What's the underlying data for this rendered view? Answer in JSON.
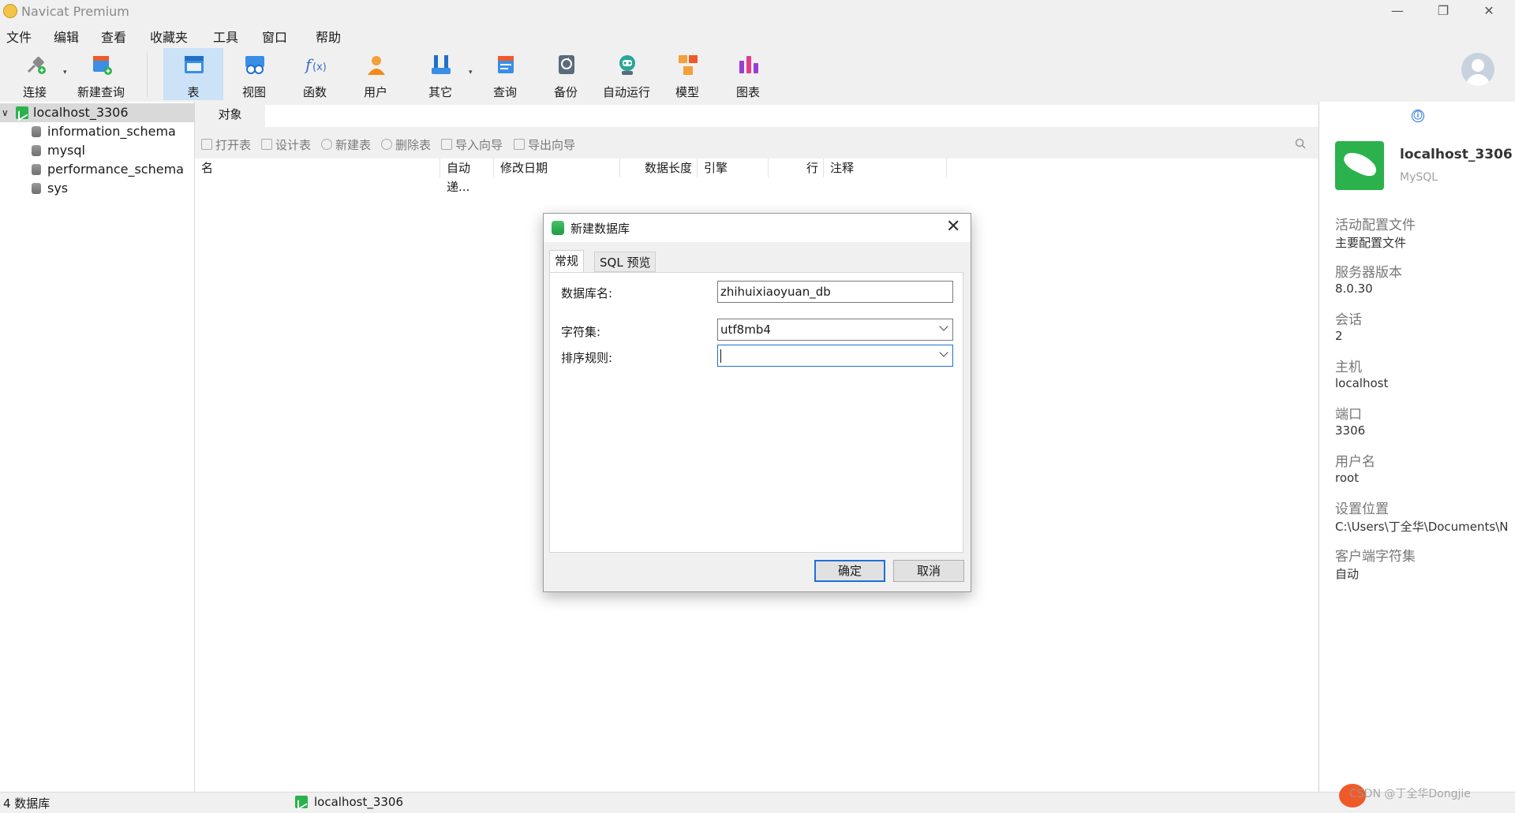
{
  "window": {
    "title": "Navicat Premium",
    "controls": [
      "—",
      "❐",
      "✕"
    ]
  },
  "menu": [
    "文件",
    "编辑",
    "查看",
    "收藏夹",
    "工具",
    "窗口",
    "帮助"
  ],
  "toolbar": {
    "connect": "连接",
    "new_query": "新建查询",
    "table": "表",
    "view": "视图",
    "function": "函数",
    "user": "用户",
    "other": "其它",
    "query": "查询",
    "backup": "备份",
    "automation": "自动运行",
    "model": "模型",
    "chart": "图表",
    "active": "table"
  },
  "tree": {
    "connection": "localhost_3306",
    "expand_icon": "∨",
    "databases": [
      "information_schema",
      "mysql",
      "performance_schema",
      "sys"
    ]
  },
  "objects": {
    "tab_label": "对象",
    "actions": [
      "打开表",
      "设计表",
      "新建表",
      "删除表",
      "导入向导",
      "导出向导"
    ],
    "columns": [
      "名",
      "自动递...",
      "修改日期",
      "数据长度",
      "引擎",
      "行",
      "注释"
    ]
  },
  "dialog": {
    "title": "新建数据库",
    "tabs": [
      "常规",
      "SQL 预览"
    ],
    "fields": {
      "db_name_label": "数据库名:",
      "db_name_value": "zhihuixiaoyuan_db",
      "charset_label": "字符集:",
      "charset_value": "utf8mb4",
      "collation_label": "排序规则:",
      "collation_value": ""
    },
    "ok": "确定",
    "cancel": "取消"
  },
  "info": {
    "icon": "ⓘ",
    "name": "localhost_3306",
    "type": "MySQL",
    "profile_label": "活动配置文件",
    "profile_value": "主要配置文件",
    "version_label": "服务器版本",
    "version_value": "8.0.30",
    "sessions_label": "会话",
    "sessions_value": "2",
    "host_label": "主机",
    "host_value": "localhost",
    "port_label": "端口",
    "port_value": "3306",
    "user_label": "用户名",
    "user_value": "root",
    "location_label": "设置位置",
    "location_value": "C:\\Users\\丁全华\\Documents\\N",
    "client_charset_label": "客户端字符集",
    "client_charset_value": "自动"
  },
  "status": {
    "db_count": "4 数据库",
    "connection": "localhost_3306"
  },
  "watermark": "CSDN @丁全华Dongjie",
  "colors": {
    "accent": "#1e6fd9",
    "connection_green": "#2bb24c",
    "active_tool": "#cbe2f7"
  }
}
